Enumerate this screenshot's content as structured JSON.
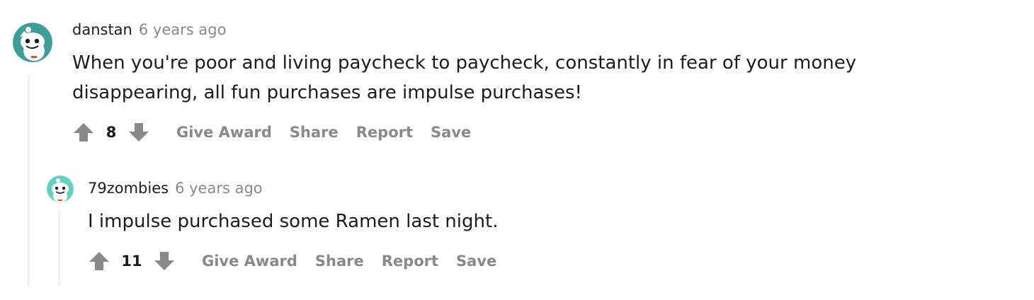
{
  "comments": [
    {
      "author": "danstan",
      "time": "6 years ago",
      "body": "When you're poor and living paycheck to paycheck, constantly in fear of your money disappearing, all fun purchases are impulse purchases!",
      "score": "8",
      "actions": {
        "give_award": "Give Award",
        "share": "Share",
        "report": "Report",
        "save": "Save"
      }
    },
    {
      "author": "79zombies",
      "time": "6 years ago",
      "body": "I impulse purchased some Ramen last night.",
      "score": "11",
      "actions": {
        "give_award": "Give Award",
        "share": "Share",
        "report": "Report",
        "save": "Save"
      }
    }
  ],
  "colors": {
    "avatar_bg": "#3d9d98",
    "text": "#1c1c1c",
    "muted": "#878a8c",
    "thread_line": "#edeff1"
  },
  "icons": [
    "snoo-avatar-icon",
    "upvote-arrow-icon",
    "downvote-arrow-icon"
  ]
}
